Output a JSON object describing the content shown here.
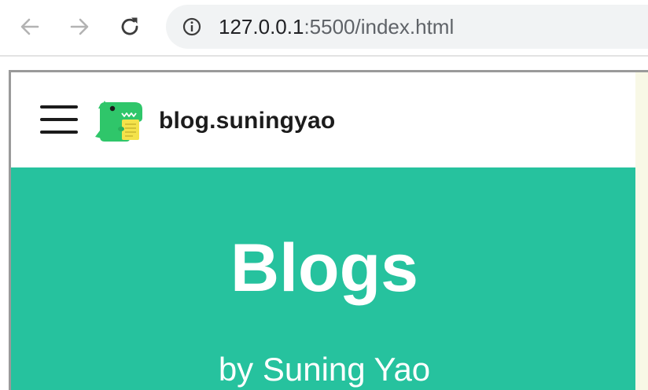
{
  "browser": {
    "url_host": "127.0.0.1",
    "url_rest": ":5500/index.html",
    "back_icon": "arrow-left-icon",
    "forward_icon": "arrow-right-icon",
    "reload_icon": "reload-icon",
    "info_icon": "info-icon"
  },
  "site": {
    "title": "blog.suningyao",
    "menu_icon": "hamburger-menu-icon",
    "logo_icon": "dinosaur-logo-icon"
  },
  "hero": {
    "title": "Blogs",
    "subtitle": "by Suning Yao"
  },
  "colors": {
    "accent": "#26c29e",
    "logo_green": "#2fc66a",
    "logo_paper": "#f4e24a"
  }
}
